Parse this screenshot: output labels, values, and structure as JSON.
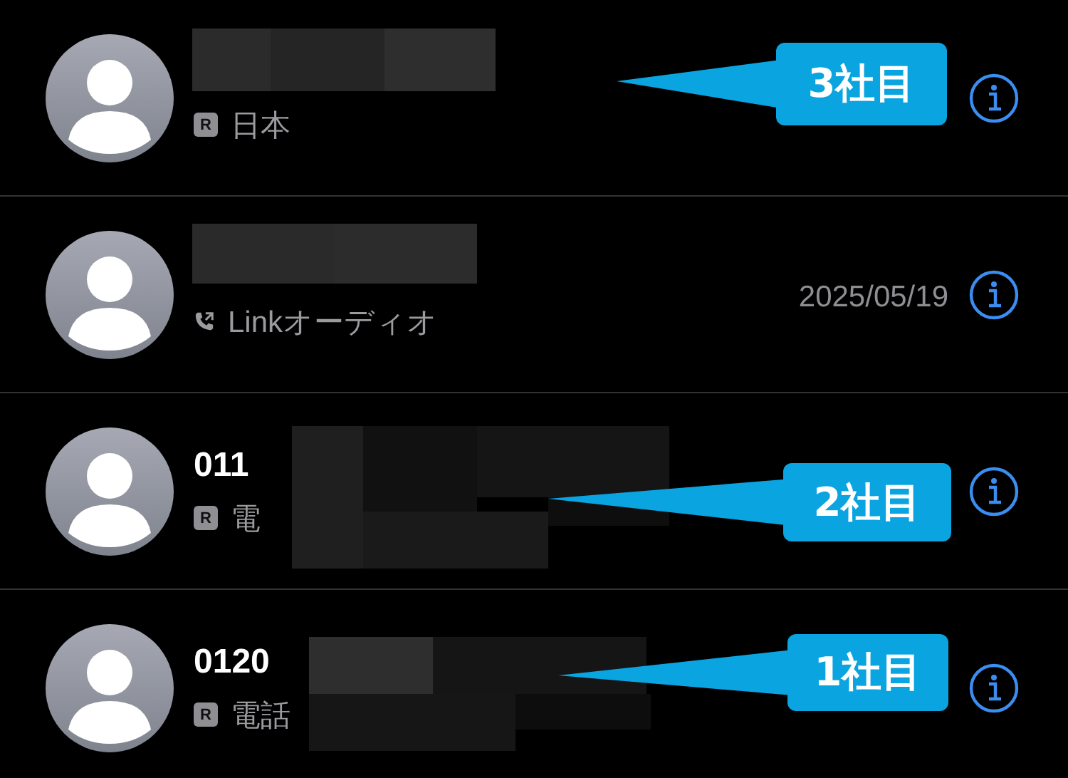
{
  "rows": [
    {
      "name_redacted": true,
      "kind": "badge",
      "badge": "R",
      "subtitle": "日本",
      "callout": "3社目"
    },
    {
      "name_redacted": true,
      "kind": "linked-call",
      "subtitle": "Linkオーディオ",
      "date": "2025/05/19"
    },
    {
      "name": "011",
      "name_redacted": true,
      "kind": "badge",
      "badge": "R",
      "subtitle": "電",
      "callout": "2社目"
    },
    {
      "name": "0120",
      "name_redacted": true,
      "kind": "badge",
      "badge": "R",
      "subtitle": "電話",
      "callout": "1社目"
    }
  ]
}
